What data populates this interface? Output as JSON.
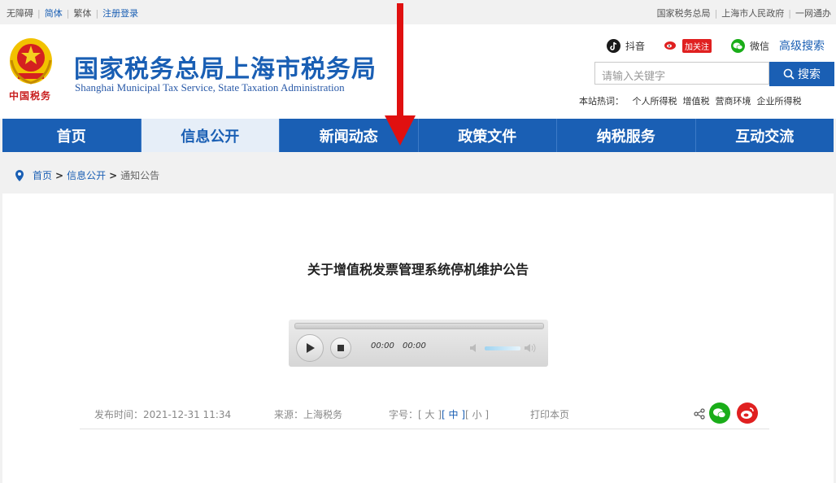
{
  "topbar": {
    "left": [
      "无障碍",
      "简体",
      "繁体",
      "注册登录"
    ],
    "right": [
      "国家税务总局",
      "上海市人民政府",
      "一网通办"
    ]
  },
  "header": {
    "calligraphy": "中国税务",
    "title": "国家税务总局上海市税务局",
    "subtitle": "Shanghai Municipal Tax Service, State Taxation Administration",
    "social": {
      "douyin": "抖音",
      "weibo_follow": "加关注",
      "wechat": "微信",
      "advanced_search": "高级搜索"
    },
    "search": {
      "placeholder": "请输入关键字",
      "button": "搜索"
    },
    "hot": {
      "label": "本站热词：",
      "terms": [
        "个人所得税",
        "增值税",
        "营商环境",
        "企业所得税"
      ]
    }
  },
  "nav": {
    "items": [
      "首页",
      "信息公开",
      "新闻动态",
      "政策文件",
      "纳税服务",
      "互动交流"
    ],
    "active_index": 1
  },
  "breadcrumb": {
    "home": "首页",
    "section": "信息公开",
    "current": "通知公告",
    "sep": ">"
  },
  "article": {
    "title": "关于增值税发票管理系统停机维护公告",
    "player": {
      "current_time": "00:00",
      "duration": "00:00"
    },
    "meta": {
      "publish": "发布时间：2021-12-31 11:34",
      "source": "来源：上海税务",
      "font_label": "字号：",
      "sizes": [
        "[ 大 ]",
        "[ 中 ]",
        "[ 小 ]"
      ],
      "print": "打印本页"
    }
  },
  "colors": {
    "brand": "#1a5fb4",
    "arrow": "#e01010",
    "wechat": "#1aad19",
    "weibo": "#e02020"
  }
}
